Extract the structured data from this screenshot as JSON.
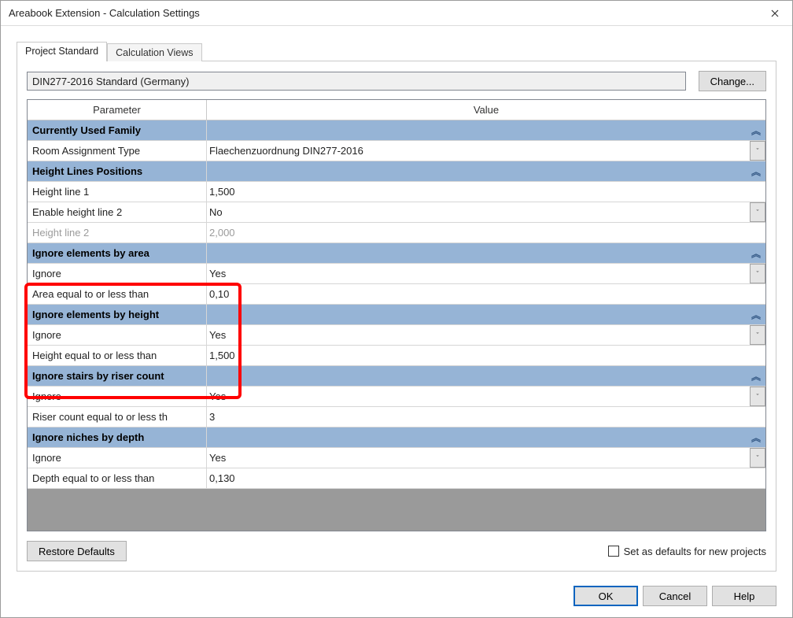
{
  "window": {
    "title": "Areabook Extension - Calculation Settings"
  },
  "tabs": {
    "standard": "Project Standard",
    "views": "Calculation Views"
  },
  "standard_select": "DIN277-2016 Standard (Germany)",
  "change_btn": "Change...",
  "headers": {
    "param": "Parameter",
    "value": "Value"
  },
  "groups": {
    "cur_family": "Currently Used Family",
    "height_lines": "Height Lines Positions",
    "ign_area": "Ignore elements by area",
    "ign_height": "Ignore elements by height",
    "ign_stairs": "Ignore stairs by riser count",
    "ign_niches": "Ignore niches by depth"
  },
  "rows": {
    "room_assign": {
      "label": "Room Assignment Type",
      "value": "Flaechenzuordnung DIN277-2016"
    },
    "h1": {
      "label": "Height line 1",
      "value": "1,500"
    },
    "enable_h2": {
      "label": "Enable height line 2",
      "value": "No"
    },
    "h2": {
      "label": "Height line 2",
      "value": "2,000"
    },
    "ign_area_flag": {
      "label": "Ignore",
      "value": "Yes"
    },
    "area_lte": {
      "label": "Area equal to or less than",
      "value": "0,10"
    },
    "ign_height_flag": {
      "label": "Ignore",
      "value": "Yes"
    },
    "height_lte": {
      "label": "Height equal to or less than",
      "value": "1,500"
    },
    "ign_stairs_flag": {
      "label": "Ignore",
      "value": "Yes"
    },
    "riser_lte": {
      "label": "Riser count equal to or less th",
      "value": "3"
    },
    "ign_niches_flag": {
      "label": "Ignore",
      "value": "Yes"
    },
    "depth_lte": {
      "label": "Depth equal to or less than",
      "value": "0,130"
    }
  },
  "restore_btn": "Restore Defaults",
  "defaults_checkbox": "Set as defaults for new projects",
  "dlg": {
    "ok": "OK",
    "cancel": "Cancel",
    "help": "Help"
  },
  "chevron": "︽",
  "caret": "ˇ"
}
